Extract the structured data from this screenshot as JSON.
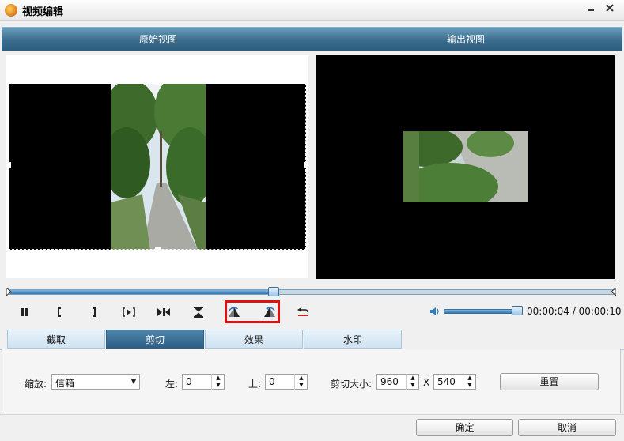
{
  "window": {
    "title": "视频编辑",
    "minimize_icon": "minimize-icon",
    "close_icon": "close-icon"
  },
  "views": {
    "original_label": "原始视图",
    "output_label": "输出视图"
  },
  "timeline": {
    "progress": 0.435
  },
  "player": {
    "buttons": [
      "pause-icon",
      "mark-in-icon",
      "mark-out-icon",
      "next-frame-icon",
      "split-icon",
      "flip-vertical-icon",
      "rotate-left-icon",
      "rotate-right-icon",
      "undo-icon"
    ],
    "volume": 0.9,
    "time": "00:00:04 / 00:00:10"
  },
  "tabs": [
    {
      "label": "截取",
      "active": false
    },
    {
      "label": "剪切",
      "active": true
    },
    {
      "label": "效果",
      "active": false
    },
    {
      "label": "水印",
      "active": false
    }
  ],
  "crop": {
    "zoom_label": "缩放:",
    "zoom_value": "信箱",
    "left_label": "左:",
    "left_value": "0",
    "top_label": "上:",
    "top_value": "0",
    "size_label": "剪切大小:",
    "width_value": "960",
    "x_label": "X",
    "height_value": "540",
    "reset_label": "重置"
  },
  "footer": {
    "ok_label": "确定",
    "cancel_label": "取消"
  },
  "colors": {
    "header_blue": "#3a6d8e",
    "highlight_red": "#e01010",
    "active_tab": "#2d5f85"
  }
}
